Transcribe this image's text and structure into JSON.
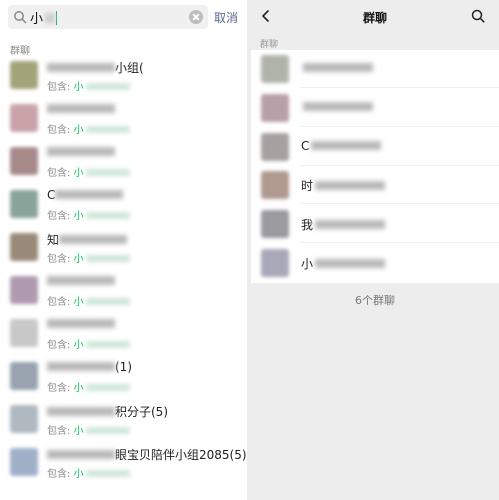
{
  "search": {
    "query": "小",
    "cancel_label": "取消"
  },
  "left": {
    "section_label": "群聊",
    "results": [
      {
        "name_prefix": "",
        "name_suffix": "小组(",
        "sub_label": "包含:",
        "sub_highlight": "小"
      },
      {
        "name_prefix": "",
        "name_suffix": "",
        "sub_label": "包含:",
        "sub_highlight": "小"
      },
      {
        "name_prefix": "",
        "name_suffix": "",
        "sub_label": "包含:",
        "sub_highlight": "小"
      },
      {
        "name_prefix": "C",
        "name_suffix": "",
        "sub_label": "包含:",
        "sub_highlight": "小"
      },
      {
        "name_prefix": "知",
        "name_suffix": "",
        "sub_label": "包含:",
        "sub_highlight": "小"
      },
      {
        "name_prefix": "",
        "name_suffix": "",
        "sub_label": "包含:",
        "sub_highlight": "小"
      },
      {
        "name_prefix": "",
        "name_suffix": "",
        "sub_label": "包含:",
        "sub_highlight": "小"
      },
      {
        "name_prefix": "",
        "name_suffix": "(1)",
        "sub_label": "包含:",
        "sub_highlight": "小"
      },
      {
        "name_prefix": "",
        "name_suffix": "积分子(5)",
        "sub_label": "包含:",
        "sub_highlight": "小"
      },
      {
        "name_prefix": "",
        "name_suffix": "眼宝贝陪伴小组2085(5)",
        "sub_label": "包含:",
        "sub_highlight": "小"
      }
    ]
  },
  "right": {
    "title": "群聊",
    "section_label": "群聊",
    "groups": [
      {
        "name_prefix": ""
      },
      {
        "name_prefix": ""
      },
      {
        "name_prefix": "C"
      },
      {
        "name_prefix": "时"
      },
      {
        "name_prefix": "我"
      },
      {
        "name_prefix": "小"
      }
    ],
    "count_label": "6个群聊"
  },
  "colors": {
    "accent_green": "#07c160",
    "link_blue": "#576b95",
    "bg_gray": "#ededed"
  },
  "icons": {
    "search": "search-icon",
    "clear": "clear-icon",
    "back": "chevron-left-icon",
    "loading": "loading-icon"
  }
}
